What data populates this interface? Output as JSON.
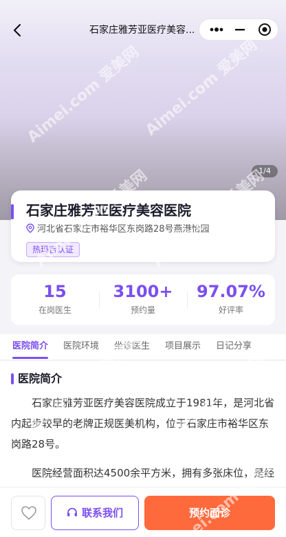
{
  "navbar": {
    "back_icon": "back-arrow-icon",
    "title": "石家庄雅芳亚医疗美容..."
  },
  "hero": {
    "badge": "1/4"
  },
  "hospital": {
    "name": "石家庄雅芳亚医疗美容医院",
    "address": "河北省石家庄市裕华区东岗路28号燕港怡园",
    "certification": "热玛吉认证"
  },
  "stats": [
    {
      "value": "15",
      "label": "在岗医生"
    },
    {
      "value": "3100+",
      "label": "预约量"
    },
    {
      "value": "97.07%",
      "label": "好评率"
    }
  ],
  "tabs": [
    {
      "label": "医院简介"
    },
    {
      "label": "医院环境"
    },
    {
      "label": "坐诊医生"
    },
    {
      "label": "项目展示"
    },
    {
      "label": "日记分享"
    }
  ],
  "intro": {
    "title": "医院简介",
    "paragraph1": "石家庄雅芳亚医疗美容医院成立于1981年，是河北省内起步较早的老牌正规医美机构，位于石家庄市裕华区东岗路28号。",
    "paragraph2": "医院经营面积达4500余平方米，拥有多张床位，是经"
  },
  "bottom": {
    "favorite_icon": "heart-icon",
    "contact_label": "联系我们",
    "book_label": "预约面诊"
  },
  "watermark": "Aimei.com 爱美网",
  "colors": {
    "accent": "#7b4ff0",
    "book": "#ff6a3d"
  }
}
